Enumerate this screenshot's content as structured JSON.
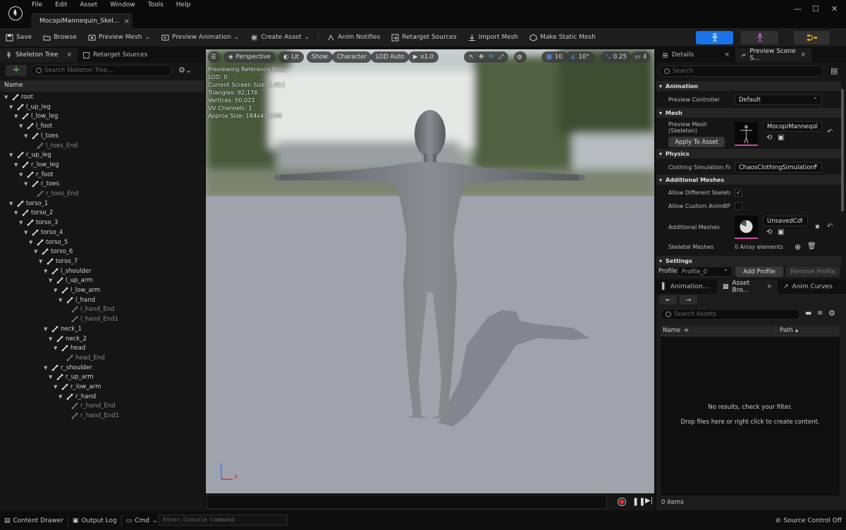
{
  "titlebar": {
    "menu": [
      "File",
      "Edit",
      "Asset",
      "Window",
      "Tools",
      "Help"
    ],
    "doc_tab": "MocopiMannequin_Skel...",
    "doc_close": "×",
    "min": "—",
    "max": "☐",
    "close": "✕"
  },
  "toolbar": {
    "save": "Save",
    "browse": "Browse",
    "preview_mesh": "Preview Mesh",
    "preview_animation": "Preview Animation",
    "create_asset": "Create Asset",
    "anim_notifies": "Anim Notifies",
    "retarget_sources": "Retarget Sources",
    "import_mesh": "Import Mesh",
    "make_static_mesh": "Make Static Mesh"
  },
  "colors": {
    "accent": "#0070e0",
    "mode_blue": "#1a74e8",
    "mode_dark": "#303030",
    "viewport_floor": "#9ea3ac"
  },
  "left": {
    "tab1": "Skeleton Tree",
    "tab1_close": "×",
    "tab2": "Retarget Sources",
    "search_placeholder": "Search Skeleton Tree...",
    "add": "+",
    "col_name": "Name",
    "bones": [
      {
        "label": "root",
        "depth": 0,
        "caret": true,
        "dim": false
      },
      {
        "label": "l_up_leg",
        "depth": 1,
        "caret": true,
        "dim": false
      },
      {
        "label": "l_low_leg",
        "depth": 2,
        "caret": true,
        "dim": false
      },
      {
        "label": "l_foot",
        "depth": 3,
        "caret": true,
        "dim": false
      },
      {
        "label": "l_toes",
        "depth": 4,
        "caret": true,
        "dim": false
      },
      {
        "label": "l_toes_End",
        "depth": 5,
        "caret": false,
        "dim": true
      },
      {
        "label": "r_up_leg",
        "depth": 1,
        "caret": true,
        "dim": false
      },
      {
        "label": "r_low_leg",
        "depth": 2,
        "caret": true,
        "dim": false
      },
      {
        "label": "r_foot",
        "depth": 3,
        "caret": true,
        "dim": false
      },
      {
        "label": "r_toes",
        "depth": 4,
        "caret": true,
        "dim": false
      },
      {
        "label": "r_toes_End",
        "depth": 5,
        "caret": false,
        "dim": true
      },
      {
        "label": "torso_1",
        "depth": 1,
        "caret": true,
        "dim": false
      },
      {
        "label": "torso_2",
        "depth": 2,
        "caret": true,
        "dim": false
      },
      {
        "label": "torso_3",
        "depth": 3,
        "caret": true,
        "dim": false
      },
      {
        "label": "torso_4",
        "depth": 4,
        "caret": true,
        "dim": false
      },
      {
        "label": "torso_5",
        "depth": 5,
        "caret": true,
        "dim": false
      },
      {
        "label": "torso_6",
        "depth": 6,
        "caret": true,
        "dim": false
      },
      {
        "label": "torso_7",
        "depth": 7,
        "caret": true,
        "dim": false
      },
      {
        "label": "l_shoulder",
        "depth": 8,
        "caret": true,
        "dim": false
      },
      {
        "label": "l_up_arm",
        "depth": 9,
        "caret": true,
        "dim": false
      },
      {
        "label": "l_low_arm",
        "depth": 10,
        "caret": true,
        "dim": false
      },
      {
        "label": "l_hand",
        "depth": 11,
        "caret": true,
        "dim": false
      },
      {
        "label": "l_hand_End",
        "depth": 12,
        "caret": false,
        "dim": true
      },
      {
        "label": "l_hand_End1",
        "depth": 12,
        "caret": false,
        "dim": true
      },
      {
        "label": "neck_1",
        "depth": 8,
        "caret": true,
        "dim": false
      },
      {
        "label": "neck_2",
        "depth": 9,
        "caret": true,
        "dim": false
      },
      {
        "label": "head",
        "depth": 10,
        "caret": true,
        "dim": false
      },
      {
        "label": "head_End",
        "depth": 11,
        "caret": false,
        "dim": true
      },
      {
        "label": "r_shoulder",
        "depth": 8,
        "caret": true,
        "dim": false
      },
      {
        "label": "r_up_arm",
        "depth": 9,
        "caret": true,
        "dim": false
      },
      {
        "label": "r_low_arm",
        "depth": 10,
        "caret": true,
        "dim": false
      },
      {
        "label": "r_hand",
        "depth": 11,
        "caret": true,
        "dim": false
      },
      {
        "label": "r_hand_End",
        "depth": 12,
        "caret": false,
        "dim": true
      },
      {
        "label": "r_hand_End1",
        "depth": 12,
        "caret": false,
        "dim": true
      }
    ]
  },
  "viewport": {
    "perspective": "Perspective",
    "lit": "Lit",
    "show": "Show",
    "character": "Character",
    "lod": "LOD Auto",
    "play_rate": "x1.0",
    "grid": "10",
    "angle": "10°",
    "scale": "0.25",
    "camera": "4",
    "stats": [
      "Previewing Reference Pose",
      "LOD: 0",
      "Current Screen Size: 1.011",
      "Triangles: 92,176",
      "Vertices: 50,021",
      "UV Channels: 1",
      "Approx Size: 184x43x189"
    ],
    "axis_z": "z",
    "axis_x": "x"
  },
  "right": {
    "tab_details": "Details",
    "tab_details_close": "×",
    "tab_preview": "Preview Scene S...",
    "tab_preview_close": "×",
    "search_placeholder": "Search",
    "sec_animation": "Animation",
    "preview_controller_label": "Preview Controller",
    "preview_controller_value": "Default",
    "sec_mesh": "Mesh",
    "preview_mesh_label": "Preview Mesh",
    "preview_mesh_sub": "(Skeleton)",
    "preview_mesh_value": "MocopiMannequi",
    "apply_to_asset": "Apply To Asset",
    "sec_physics": "Physics",
    "clothing_label": "Clothing Simulation Fact",
    "clothing_value": "ChaosClothingSimulationF",
    "sec_additional": "Additional Meshes",
    "allow_diff_label": "Allow Different Skeletons",
    "allow_custom_label": "Allow Custom AnimBP O",
    "additional_meshes_label": "Additional Meshes",
    "additional_value": "UnsavedCol",
    "skeletal_meshes_label": "Skeletal Meshes",
    "skeletal_meshes_value": "0 Array elements",
    "sec_settings": "Settings",
    "profile_label": "Profile",
    "profile_value": "Profile_0",
    "add_profile": "Add Profile",
    "remove_profile": "Remove Profile",
    "tab_animation": "Animation...",
    "tab_asset_browser": "Asset Bro...",
    "tab_asset_browser_close": "×",
    "tab_anim_curves": "Anim Curves",
    "back": "←",
    "forward": "→",
    "asset_search_placeholder": "Search Assets",
    "col_name": "Name",
    "col_name_sort": "≑",
    "col_path": "Path",
    "col_path_sort": "▴",
    "no_results": "No results, check your filter.",
    "drop_files": "Drop files here or right click to create content.",
    "items_count": "0 items"
  },
  "bottom": {
    "content_drawer": "Content Drawer",
    "output_log": "Output Log",
    "cmd": "Cmd",
    "console_placeholder": "Enter Console Command",
    "source_control": "Source Control Off"
  }
}
